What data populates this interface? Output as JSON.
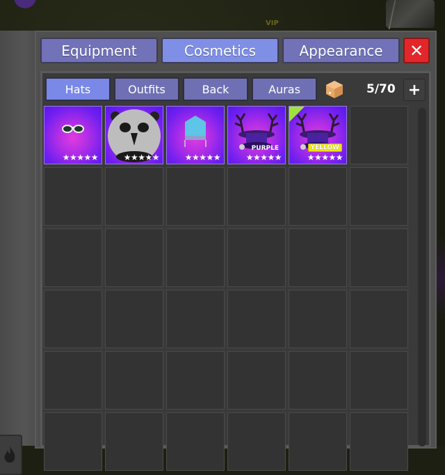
{
  "world": {
    "vip_label": "VIP"
  },
  "top_tabs": [
    {
      "label": "Equipment",
      "active": false
    },
    {
      "label": "Cosmetics",
      "active": true
    },
    {
      "label": "Appearance",
      "active": false
    }
  ],
  "close_button": {
    "icon": "close-icon",
    "glyph": "✕"
  },
  "sub_tabs": [
    {
      "label": "Hats",
      "active": true
    },
    {
      "label": "Outfits",
      "active": false
    },
    {
      "label": "Back",
      "active": false
    },
    {
      "label": "Auras",
      "active": false
    }
  ],
  "inventory": {
    "box_icon": "cardboard-box-icon",
    "count": "5/70",
    "add_button": "+"
  },
  "items": [
    {
      "name": "sunglasses-hat",
      "stars": "★★★★★",
      "tag": "",
      "new": false
    },
    {
      "name": "panda-head-hat",
      "stars": "★★★★★",
      "tag": "",
      "new": false
    },
    {
      "name": "blue-crown-hat",
      "stars": "★★★★★",
      "tag": "",
      "new": false
    },
    {
      "name": "antler-top-hat",
      "stars": "★★★★★",
      "tag": "PURPLE",
      "new": false
    },
    {
      "name": "antler-top-hat",
      "stars": "★★★★★",
      "tag": "YELLOW",
      "new": true
    }
  ],
  "grid": {
    "total_visible_slots": 36
  },
  "colors": {
    "tab": "#7172b8",
    "tab_active": "#7f8fe6",
    "close": "#e3262a",
    "item_bg": "#6e1ff0",
    "new_flag": "#9fe43a",
    "yellow_tag": "#f1e614"
  }
}
